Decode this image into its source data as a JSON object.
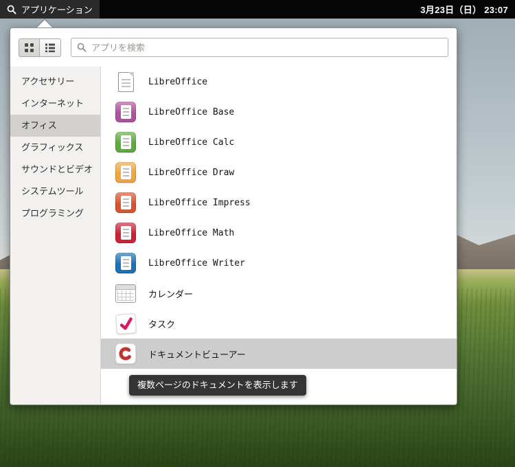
{
  "topbar": {
    "menu_label": "アプリケーション",
    "clock": "3月23日（日）  23:07"
  },
  "panel": {
    "search_placeholder": "アプリを検索"
  },
  "sidebar": {
    "selected_index": 2,
    "items": [
      {
        "label": "アクセサリー"
      },
      {
        "label": "インターネット"
      },
      {
        "label": "オフィス"
      },
      {
        "label": "グラフィックス"
      },
      {
        "label": "サウンドとビデオ"
      },
      {
        "label": "システムツール"
      },
      {
        "label": "プログラミング"
      }
    ]
  },
  "apps": [
    {
      "label": "LibreOffice"
    },
    {
      "label": "LibreOffice Base",
      "color": "#b1509e"
    },
    {
      "label": "LibreOffice Calc",
      "color": "#5cab3c"
    },
    {
      "label": "LibreOffice Draw",
      "color": "#f0a63c"
    },
    {
      "label": "LibreOffice Impress",
      "color": "#d9542e"
    },
    {
      "label": "LibreOffice Math",
      "color": "#cc2236"
    },
    {
      "label": "LibreOffice Writer",
      "color": "#1a72b8"
    },
    {
      "label": "カレンダー"
    },
    {
      "label": "タスク",
      "color": "#d81b60"
    },
    {
      "label": "ドキュメントビューアー",
      "color": "#c53030",
      "highlighted": true
    }
  ],
  "tooltip": {
    "text": "複数ページのドキュメントを表示します"
  }
}
